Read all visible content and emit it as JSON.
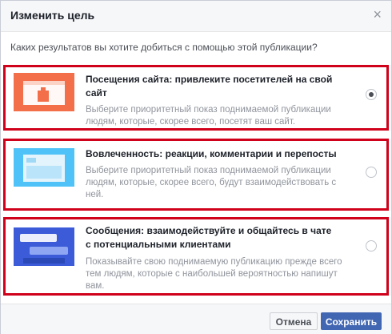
{
  "dialog": {
    "title": "Изменить цель",
    "close_glyph": "×",
    "question": "Каких результатов вы хотите добиться с помощью этой публикации?"
  },
  "options": [
    {
      "title": "Посещения сайта: привлеките посетителей на свой сайт",
      "description": "Выберите приоритетный показ поднимаемой публикации людям, которые, скорее всего, посетят ваш сайт.",
      "selected": true,
      "icon": "website-visits-illustration"
    },
    {
      "title": "Вовлеченность: реакции, комментарии и перепосты",
      "description": "Выберите приоритетный показ поднимаемой публикации людям, которые, скорее всего, будут взаимодействовать с ней.",
      "selected": false,
      "icon": "engagement-illustration"
    },
    {
      "title": "Сообщения: взаимодействуйте и общайтесь в чате с потенциальными клиентами",
      "description": "Показывайте свою поднимаемую публикацию прежде всего тем людям, которые с наибольшей вероятностью напишут вам.",
      "selected": false,
      "icon": "messages-illustration"
    }
  ],
  "footer": {
    "cancel_label": "Отмена",
    "save_label": "Сохранить"
  },
  "colors": {
    "highlight_border": "#d0021b",
    "primary_button": "#4267b2",
    "option1_bg": "#f36f4a",
    "option2_bg": "#4fc3f7",
    "option3_bg": "#3b5bd9"
  }
}
